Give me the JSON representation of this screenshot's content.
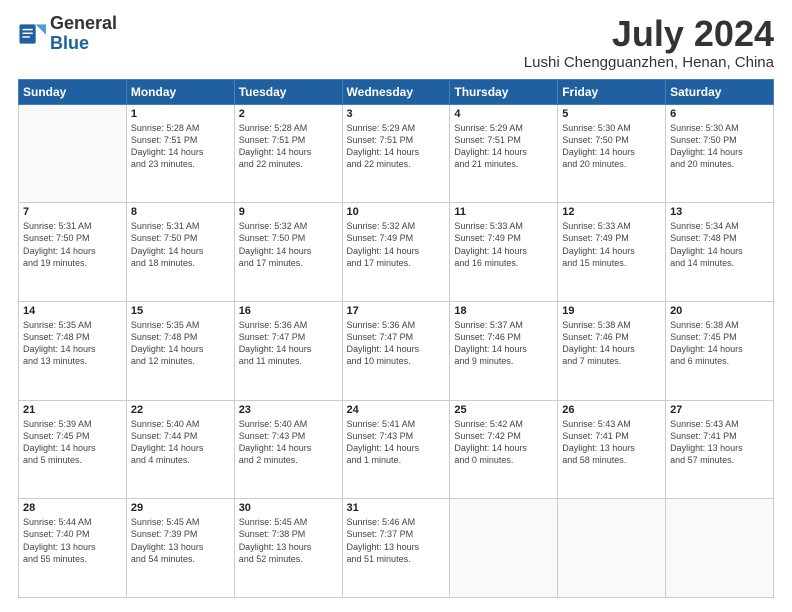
{
  "header": {
    "logo_general": "General",
    "logo_blue": "Blue",
    "month": "July 2024",
    "location": "Lushi Chengguanzhen, Henan, China"
  },
  "weekdays": [
    "Sunday",
    "Monday",
    "Tuesday",
    "Wednesday",
    "Thursday",
    "Friday",
    "Saturday"
  ],
  "weeks": [
    [
      {
        "day": "",
        "lines": []
      },
      {
        "day": "1",
        "lines": [
          "Sunrise: 5:28 AM",
          "Sunset: 7:51 PM",
          "Daylight: 14 hours",
          "and 23 minutes."
        ]
      },
      {
        "day": "2",
        "lines": [
          "Sunrise: 5:28 AM",
          "Sunset: 7:51 PM",
          "Daylight: 14 hours",
          "and 22 minutes."
        ]
      },
      {
        "day": "3",
        "lines": [
          "Sunrise: 5:29 AM",
          "Sunset: 7:51 PM",
          "Daylight: 14 hours",
          "and 22 minutes."
        ]
      },
      {
        "day": "4",
        "lines": [
          "Sunrise: 5:29 AM",
          "Sunset: 7:51 PM",
          "Daylight: 14 hours",
          "and 21 minutes."
        ]
      },
      {
        "day": "5",
        "lines": [
          "Sunrise: 5:30 AM",
          "Sunset: 7:50 PM",
          "Daylight: 14 hours",
          "and 20 minutes."
        ]
      },
      {
        "day": "6",
        "lines": [
          "Sunrise: 5:30 AM",
          "Sunset: 7:50 PM",
          "Daylight: 14 hours",
          "and 20 minutes."
        ]
      }
    ],
    [
      {
        "day": "7",
        "lines": [
          "Sunrise: 5:31 AM",
          "Sunset: 7:50 PM",
          "Daylight: 14 hours",
          "and 19 minutes."
        ]
      },
      {
        "day": "8",
        "lines": [
          "Sunrise: 5:31 AM",
          "Sunset: 7:50 PM",
          "Daylight: 14 hours",
          "and 18 minutes."
        ]
      },
      {
        "day": "9",
        "lines": [
          "Sunrise: 5:32 AM",
          "Sunset: 7:50 PM",
          "Daylight: 14 hours",
          "and 17 minutes."
        ]
      },
      {
        "day": "10",
        "lines": [
          "Sunrise: 5:32 AM",
          "Sunset: 7:49 PM",
          "Daylight: 14 hours",
          "and 17 minutes."
        ]
      },
      {
        "day": "11",
        "lines": [
          "Sunrise: 5:33 AM",
          "Sunset: 7:49 PM",
          "Daylight: 14 hours",
          "and 16 minutes."
        ]
      },
      {
        "day": "12",
        "lines": [
          "Sunrise: 5:33 AM",
          "Sunset: 7:49 PM",
          "Daylight: 14 hours",
          "and 15 minutes."
        ]
      },
      {
        "day": "13",
        "lines": [
          "Sunrise: 5:34 AM",
          "Sunset: 7:48 PM",
          "Daylight: 14 hours",
          "and 14 minutes."
        ]
      }
    ],
    [
      {
        "day": "14",
        "lines": [
          "Sunrise: 5:35 AM",
          "Sunset: 7:48 PM",
          "Daylight: 14 hours",
          "and 13 minutes."
        ]
      },
      {
        "day": "15",
        "lines": [
          "Sunrise: 5:35 AM",
          "Sunset: 7:48 PM",
          "Daylight: 14 hours",
          "and 12 minutes."
        ]
      },
      {
        "day": "16",
        "lines": [
          "Sunrise: 5:36 AM",
          "Sunset: 7:47 PM",
          "Daylight: 14 hours",
          "and 11 minutes."
        ]
      },
      {
        "day": "17",
        "lines": [
          "Sunrise: 5:36 AM",
          "Sunset: 7:47 PM",
          "Daylight: 14 hours",
          "and 10 minutes."
        ]
      },
      {
        "day": "18",
        "lines": [
          "Sunrise: 5:37 AM",
          "Sunset: 7:46 PM",
          "Daylight: 14 hours",
          "and 9 minutes."
        ]
      },
      {
        "day": "19",
        "lines": [
          "Sunrise: 5:38 AM",
          "Sunset: 7:46 PM",
          "Daylight: 14 hours",
          "and 7 minutes."
        ]
      },
      {
        "day": "20",
        "lines": [
          "Sunrise: 5:38 AM",
          "Sunset: 7:45 PM",
          "Daylight: 14 hours",
          "and 6 minutes."
        ]
      }
    ],
    [
      {
        "day": "21",
        "lines": [
          "Sunrise: 5:39 AM",
          "Sunset: 7:45 PM",
          "Daylight: 14 hours",
          "and 5 minutes."
        ]
      },
      {
        "day": "22",
        "lines": [
          "Sunrise: 5:40 AM",
          "Sunset: 7:44 PM",
          "Daylight: 14 hours",
          "and 4 minutes."
        ]
      },
      {
        "day": "23",
        "lines": [
          "Sunrise: 5:40 AM",
          "Sunset: 7:43 PM",
          "Daylight: 14 hours",
          "and 2 minutes."
        ]
      },
      {
        "day": "24",
        "lines": [
          "Sunrise: 5:41 AM",
          "Sunset: 7:43 PM",
          "Daylight: 14 hours",
          "and 1 minute."
        ]
      },
      {
        "day": "25",
        "lines": [
          "Sunrise: 5:42 AM",
          "Sunset: 7:42 PM",
          "Daylight: 14 hours",
          "and 0 minutes."
        ]
      },
      {
        "day": "26",
        "lines": [
          "Sunrise: 5:43 AM",
          "Sunset: 7:41 PM",
          "Daylight: 13 hours",
          "and 58 minutes."
        ]
      },
      {
        "day": "27",
        "lines": [
          "Sunrise: 5:43 AM",
          "Sunset: 7:41 PM",
          "Daylight: 13 hours",
          "and 57 minutes."
        ]
      }
    ],
    [
      {
        "day": "28",
        "lines": [
          "Sunrise: 5:44 AM",
          "Sunset: 7:40 PM",
          "Daylight: 13 hours",
          "and 55 minutes."
        ]
      },
      {
        "day": "29",
        "lines": [
          "Sunrise: 5:45 AM",
          "Sunset: 7:39 PM",
          "Daylight: 13 hours",
          "and 54 minutes."
        ]
      },
      {
        "day": "30",
        "lines": [
          "Sunrise: 5:45 AM",
          "Sunset: 7:38 PM",
          "Daylight: 13 hours",
          "and 52 minutes."
        ]
      },
      {
        "day": "31",
        "lines": [
          "Sunrise: 5:46 AM",
          "Sunset: 7:37 PM",
          "Daylight: 13 hours",
          "and 51 minutes."
        ]
      },
      {
        "day": "",
        "lines": []
      },
      {
        "day": "",
        "lines": []
      },
      {
        "day": "",
        "lines": []
      }
    ]
  ]
}
